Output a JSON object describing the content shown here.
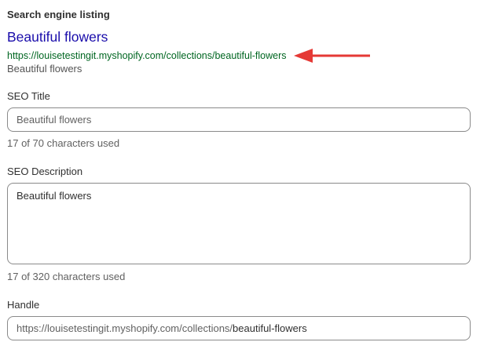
{
  "search_listing": {
    "heading": "Search engine listing",
    "preview": {
      "title": "Beautiful flowers",
      "url": "https://louisetestingit.myshopify.com/collections/beautiful-flowers",
      "description": "Beautiful flowers"
    },
    "annotation_color": "#e53935"
  },
  "seo_title": {
    "label": "SEO Title",
    "value": "Beautiful flowers",
    "help": "17 of 70 characters used"
  },
  "seo_description": {
    "label": "SEO Description",
    "value": "Beautiful flowers",
    "help": "17 of 320 characters used"
  },
  "handle": {
    "label": "Handle",
    "prefix": "https://louisetestingit.myshopify.com/collections/",
    "value": "beautiful-flowers"
  }
}
